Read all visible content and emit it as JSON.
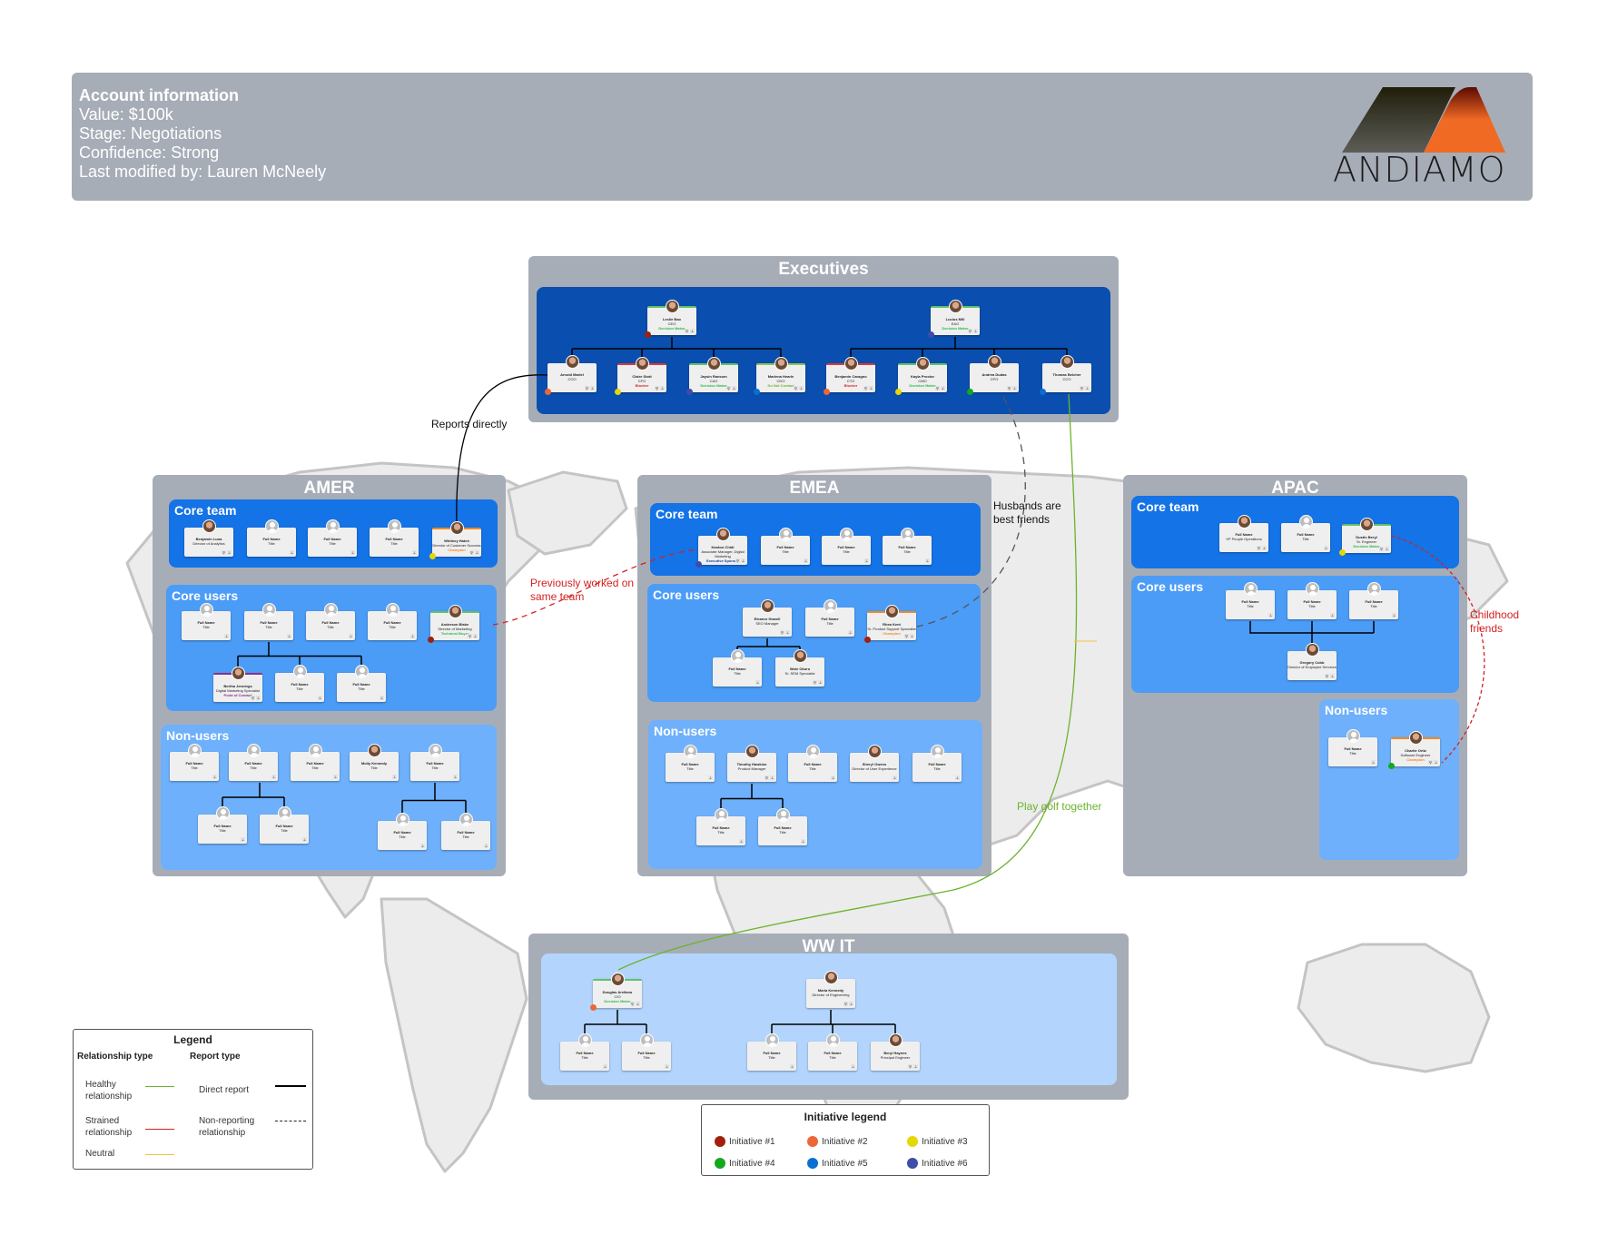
{
  "account": {
    "title": "Account information",
    "lines": [
      "Value: $100k",
      "Stage: Negotiations",
      "Confidence: Strong",
      "Last modified by: Lauren McNeely"
    ]
  },
  "logo": {
    "word": "ANDIAMO"
  },
  "colors": {
    "region_gray": "#a7adb7",
    "exec_blue": "#0a4fb0",
    "core_team": "#1473e6",
    "core_users": "#4b9cf7",
    "non_users": "#6eb0fb",
    "ww_it": "#b3d5fd",
    "healthy": "#6cb32d",
    "strained": "#d42121",
    "neutral": "#f5c242"
  },
  "regions": {
    "executives": {
      "title": "Executives"
    },
    "amer": {
      "title": "AMER",
      "core_team": "Core team",
      "core_users": "Core users",
      "non_users": "Non-users"
    },
    "emea": {
      "title": "EMEA",
      "core_team": "Core team",
      "core_users": "Core users",
      "non_users": "Non-users"
    },
    "apac": {
      "title": "APAC",
      "core_team": "Core team",
      "core_users": "Core users",
      "non_users": "Non-users"
    },
    "wwit": {
      "title": "WW IT"
    }
  },
  "people": {
    "exec_ceo": {
      "name": "Leslie Bao",
      "title": "CEO",
      "role": "Decision Maker"
    },
    "exec_coo": {
      "name": "Arnold Martel",
      "title": "COO",
      "role": ""
    },
    "exec_cfo": {
      "name": "Claire Stott",
      "title": "CFO",
      "role": "Blocker"
    },
    "exec_cao": {
      "name": "Jaysin Ransom",
      "title": "CAO",
      "role": "Decision Maker"
    },
    "exec_cdo": {
      "name": "Marlena Hearle",
      "title": "CDO",
      "role": "Do Not Contact"
    },
    "exec_eao": {
      "name": "Lucius Mill",
      "title": "EAO",
      "role": "Decision Maker"
    },
    "exec_cto": {
      "name": "Benjamin Caragno",
      "title": "CTO",
      "role": "Blocker"
    },
    "exec_cmo": {
      "name": "Kayla Proctor",
      "title": "CMO",
      "role": "Decision Maker"
    },
    "exec_cpo": {
      "name": "Andrea Dudas",
      "title": "CPO",
      "role": ""
    },
    "exec_cco": {
      "name": "Thomas Belcher",
      "title": "CCO",
      "role": ""
    },
    "amer_ct1": {
      "name": "Benjamin Luna",
      "title": "Director of Analytics",
      "role": ""
    },
    "amer_ct5": {
      "name": "Whitney Hatch",
      "title": "Director of Customer Success",
      "role": "Champion"
    },
    "amer_cu5": {
      "name": "Anderson Blake",
      "title": "Director of Marketing",
      "role": "Technical Buyer"
    },
    "amer_cu6": {
      "name": "Bertha Jennings",
      "title": "Digital Marketing Specialist",
      "role": "Point of Contact"
    },
    "amer_nu4": {
      "name": "Molly Kennedy",
      "title": "Title",
      "role": ""
    },
    "emea_ct1": {
      "name": "Kanton Chidi",
      "title": "Associate Manager, Digital Marketing",
      "role": "Executive Sponsor"
    },
    "emea_cu1": {
      "name": "Eleanor Howell",
      "title": "SEO Manager",
      "role": ""
    },
    "emea_cu3": {
      "name": "Rhea Kent",
      "title": "Sr. Product Support Specialist",
      "role": "Champion"
    },
    "emea_cu5": {
      "name": "Wole Okoro",
      "title": "Sr. SEM Specialist",
      "role": ""
    },
    "emea_nu2": {
      "name": "Timothy Hawkins",
      "title": "Product Manager",
      "role": ""
    },
    "emea_nu4": {
      "name": "Sheryl Owens",
      "title": "Director of User Experience",
      "role": ""
    },
    "apac_ct1": {
      "name": "Full Name",
      "title": "VP People Operations",
      "role": ""
    },
    "apac_ct3": {
      "name": "Dustin Beryl",
      "title": "Sr. Engineer",
      "role": "Decision Maker"
    },
    "apac_cu4": {
      "name": "Gregory Cobb",
      "title": "Director of Employee Services",
      "role": ""
    },
    "apac_nu2": {
      "name": "Charlie Ortiz",
      "title": "Software Engineer",
      "role": "Champion"
    },
    "it_cio": {
      "name": "Douglas Arellano",
      "title": "CIO",
      "role": "Decision Maker"
    },
    "it_doe": {
      "name": "Maria Kennedy",
      "title": "Director of Engineering",
      "role": ""
    },
    "it_pe": {
      "name": "Beryl Haynes",
      "title": "Principal Engineer",
      "role": ""
    },
    "placeholder": {
      "name": "Full Name",
      "title": "Title"
    }
  },
  "annotations": {
    "reports_directly": "Reports directly",
    "previously_worked": "Previously worked on same team",
    "husbands": "Husbands are best friends",
    "childhood": "Childhood friends",
    "golf": "Play golf together"
  },
  "legend": {
    "title": "Legend",
    "relationship_header": "Relationship type",
    "report_header": "Report type",
    "healthy": "Healthy relationship",
    "strained": "Strained relationship",
    "neutral": "Neutral",
    "direct": "Direct report",
    "nonreporting": "Non-reporting relationship"
  },
  "initiative_legend": {
    "title": "Initiative legend",
    "items": [
      {
        "label": "Initiative #1",
        "color": "#a31f0b"
      },
      {
        "label": "Initiative #2",
        "color": "#ee6637"
      },
      {
        "label": "Initiative #3",
        "color": "#e5d800"
      },
      {
        "label": "Initiative #4",
        "color": "#14a81e"
      },
      {
        "label": "Initiative #5",
        "color": "#0a6fd1"
      },
      {
        "label": "Initiative #6",
        "color": "#3f4da8"
      }
    ]
  }
}
